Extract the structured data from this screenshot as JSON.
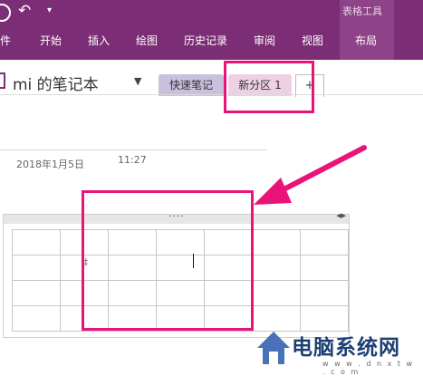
{
  "ribbon": {
    "tools_label": "表格工具",
    "tabs": [
      {
        "label": "件"
      },
      {
        "label": "开始"
      },
      {
        "label": "插入"
      },
      {
        "label": "绘图"
      },
      {
        "label": "历史记录"
      },
      {
        "label": "审阅"
      },
      {
        "label": "视图"
      },
      {
        "label": "布局"
      }
    ]
  },
  "notebook": {
    "title": "mi 的笔记本",
    "sections": [
      {
        "label": "快速笔记"
      },
      {
        "label": "新分区 1"
      },
      {
        "label": "+"
      }
    ]
  },
  "page": {
    "date": "2018年1月5日",
    "time": "11:27"
  },
  "table": {
    "rows": 4,
    "cols": 7,
    "cell_mark": "‡"
  },
  "watermark": {
    "title": "电脑系统网",
    "url": "w w w . d n x t w . c o m"
  },
  "colors": {
    "ribbon": "#7b2e75",
    "highlight": "#e8147a",
    "quick_tab": "#c9c0dd",
    "new_tab": "#eed0e5"
  },
  "icons": [
    "undo-icon",
    "customize-icon",
    "dropdown-icon",
    "plus-icon",
    "table-move-handle-icon",
    "resize-arrows-icon",
    "house-logo-icon"
  ]
}
